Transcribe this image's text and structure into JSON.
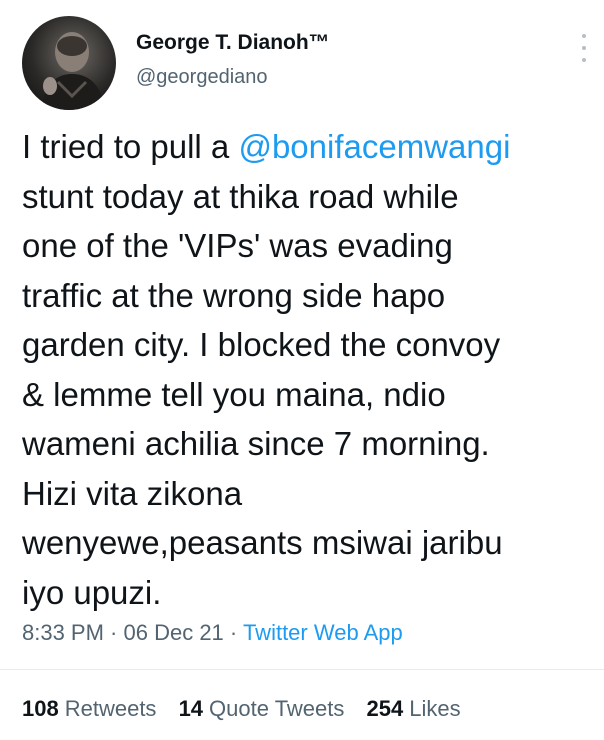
{
  "author": {
    "display_name": "George T. Dianoh™",
    "handle": "@georgediano"
  },
  "tweet": {
    "lines": [
      {
        "before": "I tried to pull a ",
        "mention": "@bonifacemwangi",
        "after": ""
      },
      {
        "before": "stunt today at thika road while",
        "mention": "",
        "after": ""
      },
      {
        "before": "one of the 'VIPs' was evading",
        "mention": "",
        "after": ""
      },
      {
        "before": "traffic at the wrong side hapo",
        "mention": "",
        "after": ""
      },
      {
        "before": "garden city. I blocked the convoy",
        "mention": "",
        "after": ""
      },
      {
        "before": "& lemme tell you maina, ndio",
        "mention": "",
        "after": ""
      },
      {
        "before": "wameni achilia since 7 morning.",
        "mention": "",
        "after": ""
      },
      {
        "before": "Hizi vita zikona",
        "mention": "",
        "after": ""
      },
      {
        "before": "wenyewe,peasants msiwai jaribu",
        "mention": "",
        "after": ""
      },
      {
        "before": "iyo upuzi.",
        "mention": "",
        "after": ""
      }
    ]
  },
  "meta": {
    "time": "8:33 PM",
    "separator": " · ",
    "date": "06 Dec 21",
    "app": "Twitter Web App"
  },
  "stats": {
    "retweets": {
      "count": "108",
      "label": "Retweets"
    },
    "quotes": {
      "count": "14",
      "label": "Quote Tweets"
    },
    "likes": {
      "count": "254",
      "label": "Likes"
    }
  },
  "colors": {
    "link": "#1d9bf0",
    "secondary_text": "#536471",
    "primary_text": "#0f1419"
  },
  "icons": {
    "more": "more-vertical-icon"
  }
}
